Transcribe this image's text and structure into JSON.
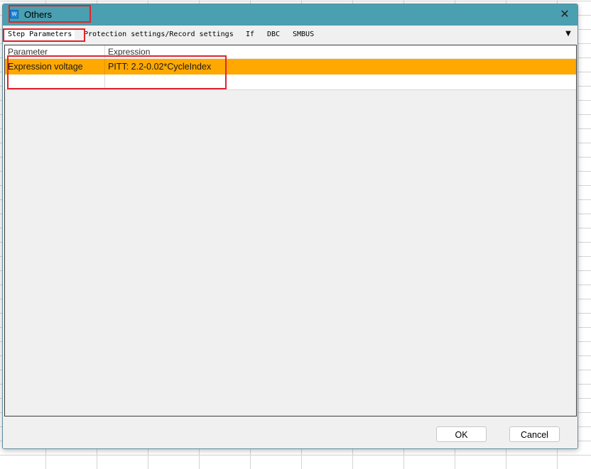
{
  "window": {
    "title": "Others",
    "icon": "app-icon",
    "close_symbol": "✕"
  },
  "tabs": [
    {
      "label": "Step Parameters",
      "active": true
    },
    {
      "label": "Protection settings/Record settings",
      "active": false
    },
    {
      "label": "If",
      "active": false
    },
    {
      "label": "DBC",
      "active": false
    },
    {
      "label": "SMBUS",
      "active": false
    }
  ],
  "tab_overflow_symbol": "▼",
  "table": {
    "columns": [
      "Parameter",
      "Expression"
    ],
    "rows": [
      {
        "parameter": "Expression voltage",
        "expression": "PITT: 2.2-0.02*CycleIndex",
        "selected": true
      },
      {
        "parameter": "",
        "expression": "",
        "selected": false
      }
    ]
  },
  "buttons": {
    "ok": "OK",
    "cancel": "Cancel"
  },
  "colors": {
    "titlebar": "#4a9fb0",
    "selected_row": "#ffa800",
    "annotation": "#e0242b"
  }
}
